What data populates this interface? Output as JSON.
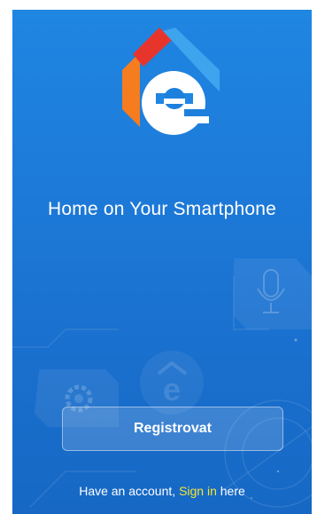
{
  "app": {
    "tagline": "Home on Your Smartphone",
    "register_label": "Registrovat",
    "signin_prefix": "Have an account, ",
    "signin_link": "Sign in",
    "signin_suffix": " here"
  },
  "colors": {
    "background_top": "#1f86e2",
    "background_bottom": "#1668c4",
    "accent_link": "#f4e533",
    "logo_orange": "#f57c1f",
    "logo_red": "#e8352c",
    "logo_blue": "#3fa4ee"
  },
  "icons": {
    "logo": "house-e-logo",
    "background_mic": "microphone-icon",
    "background_gear": "gear-icon",
    "background_logo": "house-e-logo"
  }
}
